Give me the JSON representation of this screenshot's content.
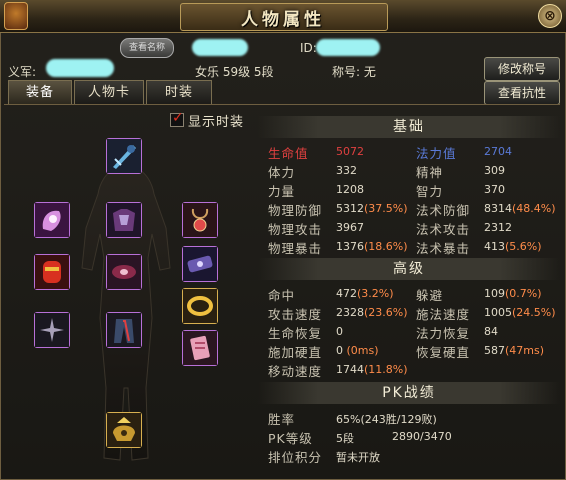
{
  "window": {
    "title": "人物属性",
    "close_glyph": "⊗"
  },
  "header": {
    "name_button": "查看名称",
    "id_label": "ID:",
    "spouse_label": "义军:",
    "char_info": "女乐 59级 5段",
    "title_label": "称号: 无",
    "modify_title_button": "修改称号",
    "view_resist_button": "查看抗性"
  },
  "tabs": [
    {
      "label": "装备"
    },
    {
      "label": "人物卡"
    },
    {
      "label": "时装"
    }
  ],
  "show_fashion": {
    "label": "显示时装",
    "checked": true,
    "check_glyph": "✓"
  },
  "basic": {
    "title": "基础",
    "hp_label": "生命值",
    "hp": "5072",
    "mp_label": "法力值",
    "mp": "2704",
    "vit_label": "体力",
    "vit": "332",
    "spi_label": "精神",
    "spi": "309",
    "str_label": "力量",
    "str": "1208",
    "int_label": "智力",
    "int": "370",
    "pdef_label": "物理防御",
    "pdef": "5312",
    "pdef_pct": "(37.5%)",
    "mdef_label": "法术防御",
    "mdef": "8314",
    "mdef_pct": "(48.4%)",
    "patk_label": "物理攻击",
    "patk": "3967",
    "matk_label": "法术攻击",
    "matk": "2312",
    "pcrit_label": "物理暴击",
    "pcrit": "1376",
    "pcrit_pct": "(18.6%)",
    "mcrit_label": "法术暴击",
    "mcrit": "413",
    "mcrit_pct": "(5.6%)"
  },
  "advanced": {
    "title": "高级",
    "hit_label": "命中",
    "hit": "472",
    "hit_pct": "(3.2%)",
    "dodge_label": "躲避",
    "dodge": "109",
    "dodge_pct": "(0.7%)",
    "aspd_label": "攻击速度",
    "aspd": "2328",
    "aspd_pct": "(23.6%)",
    "cspd_label": "施法速度",
    "cspd": "1005",
    "cspd_pct": "(24.5%)",
    "hpreg_label": "生命恢复",
    "hpreg": "0",
    "mpreg_label": "法力恢复",
    "mpreg": "84",
    "stiff_label": "施加硬直",
    "stiff": "0",
    "stiff_ms": "(0ms)",
    "recov_label": "恢复硬直",
    "recov": "587",
    "recov_ms": "(47ms)",
    "move_label": "移动速度",
    "move": "1744",
    "move_pct": "(11.8%)"
  },
  "pk": {
    "title": "PK战绩",
    "winrate_label": "胜率",
    "winrate": "65%(243胜/129败)",
    "level_label": "PK等级",
    "level": "5段",
    "points": "2890/3470",
    "rank_label": "排位积分",
    "rank": "暂未开放"
  }
}
